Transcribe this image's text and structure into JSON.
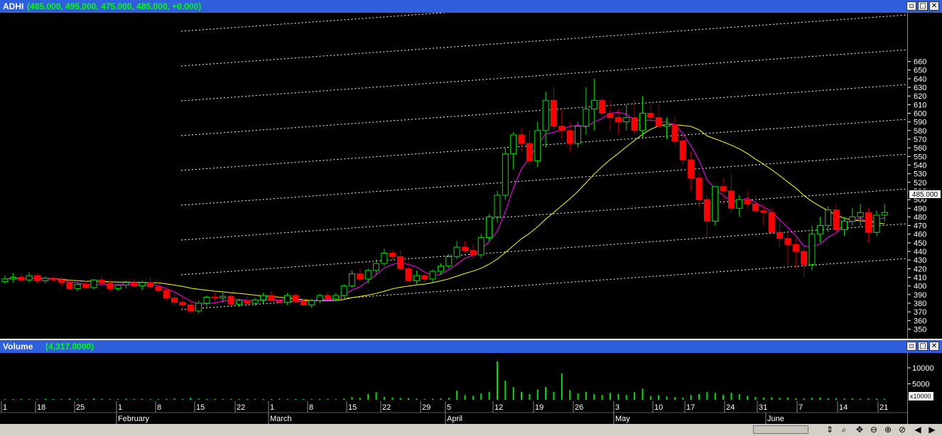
{
  "price_window": {
    "title": "ADHI",
    "values_text": "(485.000, 495.000, 475.000, 485.000, +0.000)",
    "buttons": {
      "restore": "▫",
      "maximize": "□",
      "close": "✕"
    }
  },
  "volume_window": {
    "title": "Volume",
    "values_text": "(4,317.0000)",
    "buttons": {
      "restore": "▫",
      "maximize": "□",
      "close": "✕"
    }
  },
  "last_price_label": "485.000",
  "volume_multiplier_label": "x10000",
  "colors": {
    "up": "#00e000",
    "down": "#ff0000",
    "ma_fast": "#ff00ff",
    "ma_slow": "#ffff00",
    "grid": "#ffffff"
  },
  "toolbar_icons": [
    "auto-scale-icon",
    "zoom-icon",
    "move-icon",
    "zoom-out-icon",
    "zoom-in-icon",
    "scroll-left-icon",
    "scroll-right-icon"
  ],
  "chart_data": [
    {
      "type": "candlestick",
      "title": "ADHI",
      "ylim": [
        345,
        665
      ],
      "yticks": [
        350,
        360,
        370,
        380,
        390,
        400,
        410,
        420,
        430,
        440,
        450,
        460,
        470,
        480,
        490,
        500,
        510,
        520,
        530,
        540,
        550,
        560,
        570,
        580,
        590,
        600,
        610,
        620,
        630,
        640,
        650,
        660
      ],
      "x_tick_labels": [
        "1",
        "18",
        "25",
        "1",
        "8",
        "15",
        "22",
        "1",
        "8",
        "15",
        "22",
        "29",
        "5",
        "12",
        "19",
        "26",
        "3",
        "10",
        "17",
        "24",
        "31",
        "7",
        "14",
        "21"
      ],
      "month_labels": [
        "February",
        "March",
        "April",
        "May",
        "June"
      ],
      "candles": [
        [
          405,
          412,
          402,
          408
        ],
        [
          408,
          415,
          404,
          410
        ],
        [
          410,
          414,
          405,
          407
        ],
        [
          407,
          416,
          404,
          412
        ],
        [
          412,
          415,
          403,
          406
        ],
        [
          406,
          411,
          403,
          409
        ],
        [
          409,
          412,
          404,
          407
        ],
        [
          407,
          410,
          400,
          404
        ],
        [
          404,
          408,
          396,
          397
        ],
        [
          397,
          404,
          394,
          402
        ],
        [
          402,
          406,
          397,
          398
        ],
        [
          398,
          408,
          396,
          407
        ],
        [
          407,
          412,
          402,
          403
        ],
        [
          403,
          407,
          393,
          397
        ],
        [
          397,
          403,
          394,
          401
        ],
        [
          401,
          406,
          397,
          404
        ],
        [
          404,
          408,
          399,
          400
        ],
        [
          400,
          406,
          395,
          404
        ],
        [
          404,
          410,
          398,
          399
        ],
        [
          399,
          404,
          392,
          395
        ],
        [
          395,
          399,
          383,
          386
        ],
        [
          386,
          392,
          377,
          381
        ],
        [
          381,
          388,
          373,
          378
        ],
        [
          378,
          383,
          369,
          371
        ],
        [
          371,
          383,
          368,
          380
        ],
        [
          380,
          389,
          376,
          387
        ],
        [
          387,
          392,
          382,
          386
        ],
        [
          386,
          393,
          381,
          388
        ],
        [
          388,
          392,
          378,
          379
        ],
        [
          379,
          385,
          376,
          383
        ],
        [
          383,
          388,
          378,
          380
        ],
        [
          380,
          386,
          377,
          384
        ],
        [
          384,
          392,
          380,
          389
        ],
        [
          389,
          394,
          382,
          383
        ],
        [
          383,
          388,
          379,
          381
        ],
        [
          381,
          392,
          378,
          389
        ],
        [
          389,
          392,
          380,
          382
        ],
        [
          382,
          386,
          376,
          378
        ],
        [
          378,
          385,
          375,
          383
        ],
        [
          383,
          391,
          380,
          389
        ],
        [
          389,
          393,
          384,
          385
        ],
        [
          385,
          392,
          382,
          389
        ],
        [
          389,
          402,
          387,
          400
        ],
        [
          400,
          418,
          398,
          414
        ],
        [
          414,
          420,
          406,
          408
        ],
        [
          408,
          420,
          403,
          418
        ],
        [
          418,
          431,
          413,
          426
        ],
        [
          426,
          443,
          423,
          438
        ],
        [
          438,
          441,
          430,
          434
        ],
        [
          434,
          441,
          418,
          420
        ],
        [
          420,
          428,
          404,
          406
        ],
        [
          406,
          418,
          402,
          412
        ],
        [
          412,
          418,
          405,
          408
        ],
        [
          408,
          419,
          404,
          417
        ],
        [
          417,
          426,
          413,
          423
        ],
        [
          423,
          437,
          420,
          434
        ],
        [
          434,
          452,
          431,
          445
        ],
        [
          445,
          452,
          438,
          441
        ],
        [
          441,
          448,
          432,
          436
        ],
        [
          436,
          460,
          432,
          456
        ],
        [
          456,
          483,
          452,
          480
        ],
        [
          480,
          510,
          474,
          505
        ],
        [
          505,
          560,
          500,
          553
        ],
        [
          553,
          578,
          535,
          575
        ],
        [
          575,
          583,
          555,
          565
        ],
        [
          565,
          580,
          540,
          545
        ],
        [
          545,
          590,
          538,
          580
        ],
        [
          580,
          625,
          560,
          615
        ],
        [
          615,
          630,
          580,
          585
        ],
        [
          585,
          605,
          570,
          580
        ],
        [
          580,
          590,
          555,
          565
        ],
        [
          565,
          590,
          560,
          585
        ],
        [
          585,
          630,
          575,
          605
        ],
        [
          605,
          640,
          580,
          615
        ],
        [
          615,
          618,
          592,
          600
        ],
        [
          600,
          615,
          580,
          595
        ],
        [
          595,
          605,
          575,
          590
        ],
        [
          590,
          610,
          580,
          595
        ],
        [
          595,
          615,
          575,
          580
        ],
        [
          580,
          620,
          572,
          600
        ],
        [
          600,
          610,
          590,
          595
        ],
        [
          595,
          610,
          583,
          585
        ],
        [
          585,
          595,
          570,
          587
        ],
        [
          587,
          595,
          563,
          568
        ],
        [
          568,
          575,
          540,
          546
        ],
        [
          546,
          556,
          510,
          525
        ],
        [
          525,
          532,
          490,
          500
        ],
        [
          500,
          505,
          455,
          475
        ],
        [
          475,
          515,
          470,
          515
        ],
        [
          515,
          525,
          495,
          510
        ],
        [
          510,
          530,
          485,
          490
        ],
        [
          490,
          505,
          480,
          500
        ],
        [
          500,
          510,
          490,
          495
        ],
        [
          495,
          505,
          484,
          487
        ],
        [
          487,
          495,
          470,
          485
        ],
        [
          485,
          490,
          465,
          462
        ],
        [
          462,
          478,
          445,
          455
        ],
        [
          455,
          462,
          425,
          448
        ],
        [
          448,
          455,
          420,
          440
        ],
        [
          440,
          445,
          410,
          425
        ],
        [
          425,
          470,
          418,
          460
        ],
        [
          460,
          480,
          450,
          470
        ],
        [
          470,
          492,
          462,
          488
        ],
        [
          488,
          495,
          460,
          465
        ],
        [
          465,
          480,
          458,
          475
        ],
        [
          475,
          490,
          470,
          480
        ],
        [
          480,
          495,
          470,
          485
        ],
        [
          485,
          490,
          450,
          462
        ],
        [
          462,
          487,
          458,
          482
        ],
        [
          482,
          495,
          475,
          485
        ]
      ]
    },
    {
      "type": "bar",
      "title": "Volume",
      "unit_label": "x10000",
      "ylim": [
        0,
        12000
      ],
      "yticks": [
        5000,
        10000
      ],
      "values": [
        200,
        150,
        250,
        180,
        220,
        300,
        150,
        180,
        400,
        250,
        180,
        450,
        300,
        250,
        200,
        350,
        150,
        250,
        180,
        200,
        300,
        400,
        250,
        600,
        350,
        200,
        250,
        180,
        300,
        220,
        180,
        250,
        200,
        150,
        300,
        250,
        180,
        200,
        250,
        220,
        200,
        250,
        400,
        900,
        600,
        1800,
        2400,
        900,
        700,
        600,
        500,
        350,
        250,
        300,
        400,
        600,
        2800,
        1500,
        1200,
        2000,
        2500,
        12000,
        6000,
        4000,
        2500,
        1800,
        3200,
        4000,
        2500,
        8200,
        3000,
        2000,
        2500,
        1800,
        1500,
        2200,
        1800,
        1500,
        2400,
        3500,
        1200,
        1500,
        1000,
        800,
        700,
        1500,
        1800,
        2500,
        2200,
        1500,
        2200,
        1800,
        1200,
        900,
        700,
        800,
        600,
        700,
        500,
        400,
        600,
        700,
        450,
        500,
        400,
        450,
        300,
        400,
        350,
        300
      ]
    }
  ]
}
